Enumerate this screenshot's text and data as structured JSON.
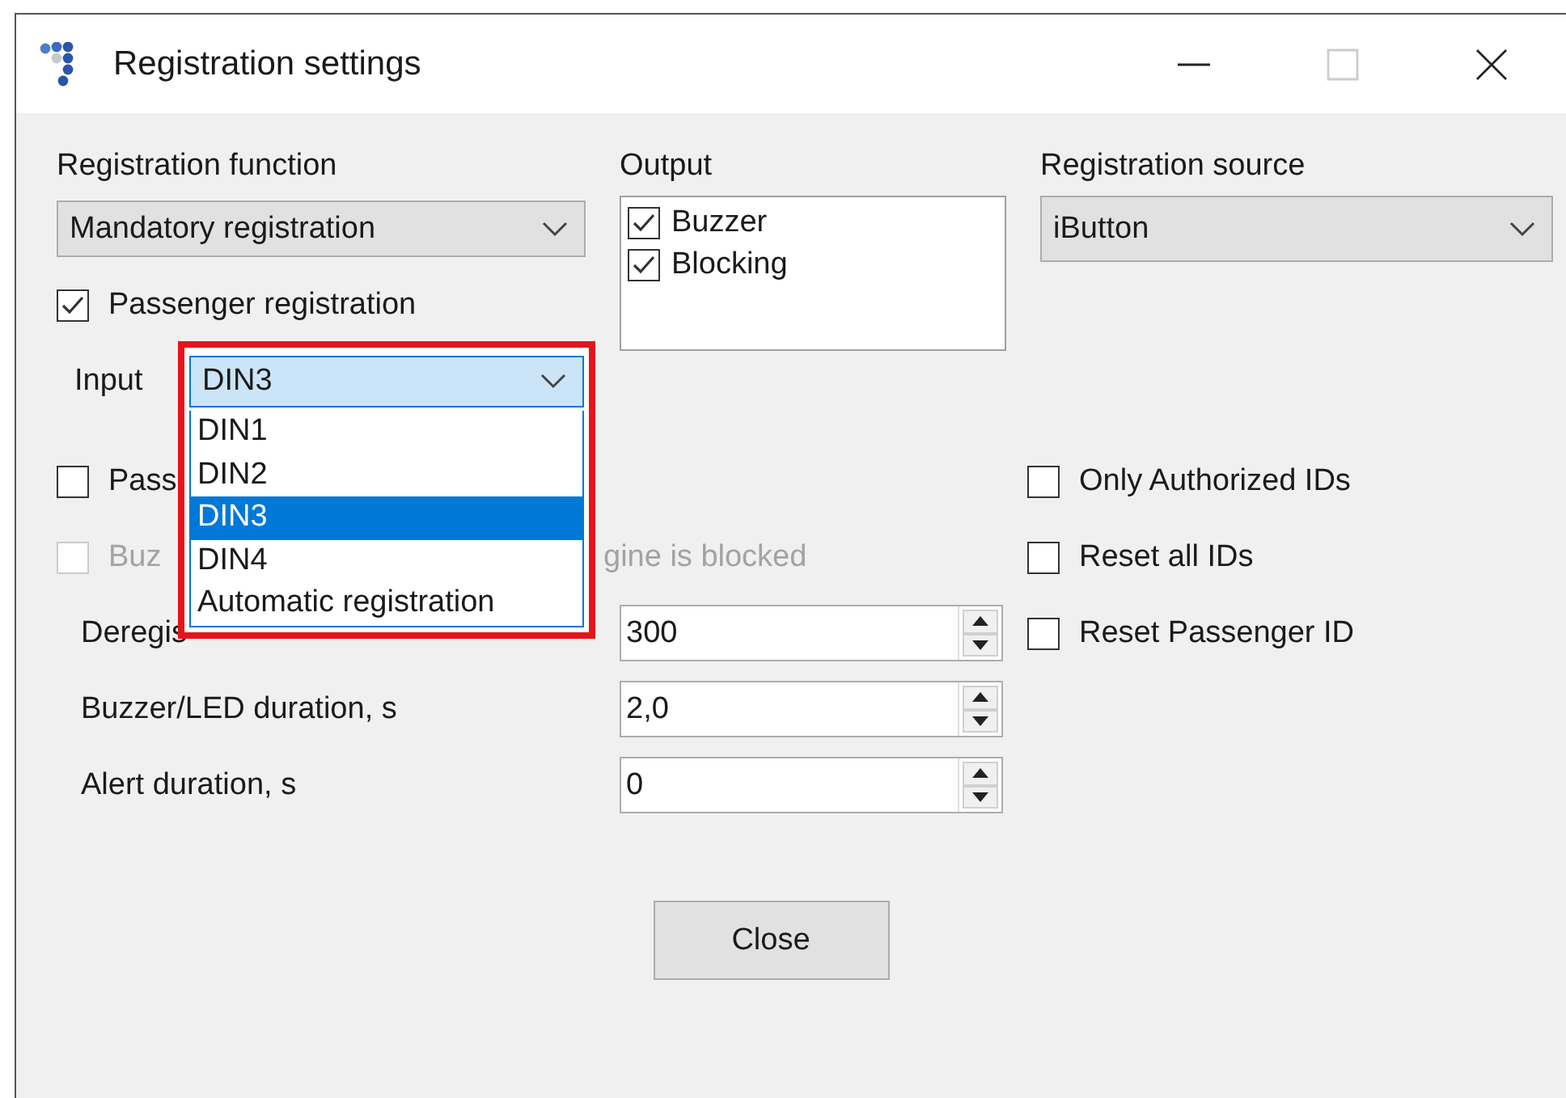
{
  "window": {
    "title": "Registration settings"
  },
  "registration_function": {
    "label": "Registration function",
    "value": "Mandatory registration"
  },
  "passenger_registration": {
    "label": "Passenger registration",
    "checked": true
  },
  "output": {
    "label": "Output",
    "items": [
      {
        "label": "Buzzer",
        "checked": true
      },
      {
        "label": "Blocking",
        "checked": true
      }
    ]
  },
  "registration_source": {
    "label": "Registration source",
    "value": "iButton"
  },
  "input": {
    "label": "Input",
    "value": "DIN3",
    "expanded": true,
    "options": [
      {
        "label": "DIN1",
        "selected": false
      },
      {
        "label": "DIN2",
        "selected": false
      },
      {
        "label": "DIN3",
        "selected": true
      },
      {
        "label": "DIN4",
        "selected": false
      },
      {
        "label": "Automatic registration",
        "selected": false
      }
    ]
  },
  "left_checkboxes": [
    {
      "label": "Pass",
      "checked": false,
      "disabled": false
    },
    {
      "label": "Buz",
      "label_continued": "gine is blocked",
      "checked": false,
      "disabled": true
    }
  ],
  "right_checkboxes": [
    {
      "label": "Only Authorized IDs",
      "checked": false
    },
    {
      "label": "Reset all IDs",
      "checked": false
    },
    {
      "label": "Reset Passenger ID",
      "checked": false
    }
  ],
  "spin_fields": [
    {
      "label": "Deregis",
      "value": "300"
    },
    {
      "label": "Buzzer/LED duration, s",
      "value": "2,0"
    },
    {
      "label": "Alert duration, s",
      "value": "0"
    }
  ],
  "close_button": "Close"
}
